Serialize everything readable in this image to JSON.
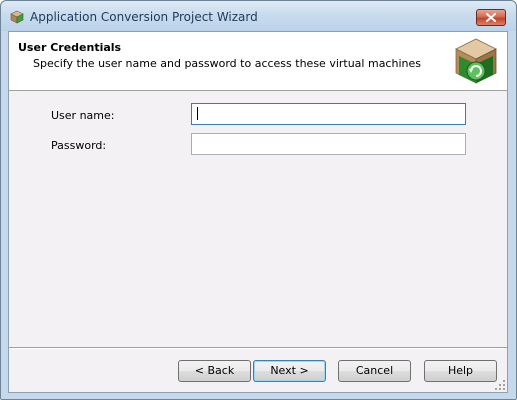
{
  "window": {
    "title": "Application Conversion Project Wizard"
  },
  "header": {
    "title": "User Credentials",
    "subtitle": "Specify the user name and password to access these virtual machines"
  },
  "form": {
    "username_label": "User name:",
    "username_value": "",
    "password_label": "Password:",
    "password_value": ""
  },
  "buttons": {
    "back": "< Back",
    "next": "Next >",
    "cancel": "Cancel",
    "help": "Help"
  },
  "icons": {
    "title": "wizard-app-icon",
    "close": "close-icon",
    "logo": "green-cube-logo-icon",
    "grip": "resize-grip-icon"
  },
  "colors": {
    "titlebar": "#c9dced",
    "close": "#c2452a",
    "client": "#f4f1f5",
    "logo_green": "#3a9a3a"
  }
}
